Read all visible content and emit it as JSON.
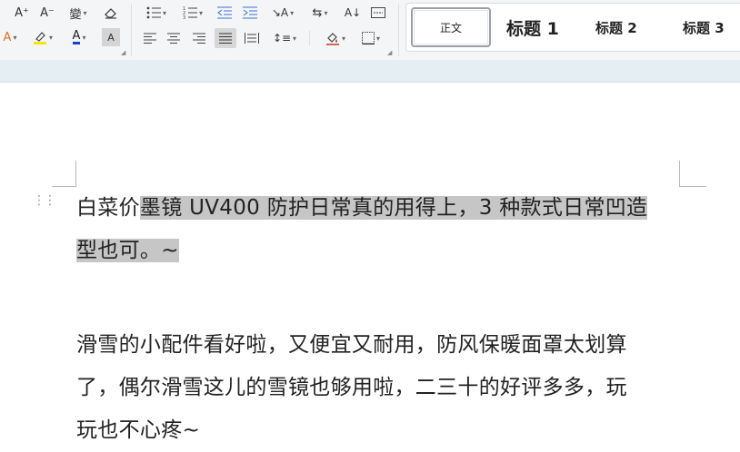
{
  "ribbon": {
    "font_group": {
      "grow_font_label": "A⁺",
      "shrink_font_label": "A⁻",
      "phonetic_label": "變",
      "clear_format_label": "◇",
      "text_effect_label": "A",
      "highlight_label": "A",
      "font_color_label": "A",
      "char_shading_label": "A",
      "highlight_color": "#f5e900",
      "font_color": "#1a3fd1"
    },
    "styles": {
      "normal": "正文",
      "heading1": "标题  1",
      "heading2": "标题  2",
      "heading3": "标题  3"
    }
  },
  "document": {
    "para1_unselected": "白菜价",
    "para1_selected_line1": "墨镜 UV400 防护日常真的用得上，3 种款式日常凹造",
    "para1_selected_line2": "型也可。~",
    "para2_lines": [
      "滑雪的小配件看好啦，又便宜又耐用，防风保暖面罩太划算",
      "了，偶尔滑雪这儿的雪镜也够用啦，二三十的好评多多，玩",
      "玩也不心疼~"
    ]
  }
}
